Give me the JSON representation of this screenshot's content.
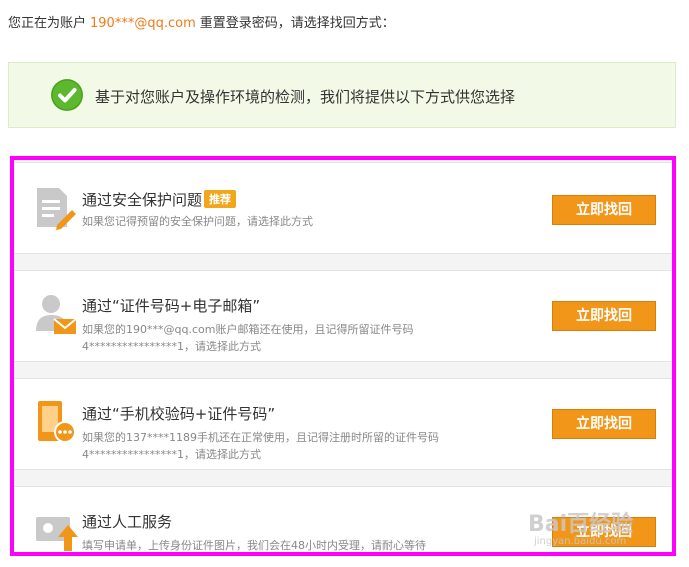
{
  "header": {
    "prefix": "您正在为账户",
    "account": "190***@qq.com",
    "suffix": "重置登录密码，请选择找回方式："
  },
  "notice": {
    "icon": "check-circle-icon",
    "message": "基于对您账户及操作环境的检测，我们将提供以下方式供您选择"
  },
  "options": [
    {
      "icon": "document-pencil-icon",
      "title": "通过安全保护问题",
      "badge": "推荐",
      "desc1": "如果您记得预留的安全保护问题，请选择此方式",
      "desc2": "",
      "button": "立即找回"
    },
    {
      "icon": "person-mail-icon",
      "title": "通过“证件号码+电子邮箱”",
      "desc1": "如果您的190***@qq.com账户邮箱还在使用，且记得所留证件号码",
      "desc2": "4****************1，请选择此方式",
      "button": "立即找回"
    },
    {
      "icon": "phone-message-icon",
      "title": "通过“手机校验码+证件号码”",
      "desc1": "如果您的137****1189手机还在正常使用，且记得注册时所留的证件号码",
      "desc2": "4****************1，请选择此方式",
      "button": "立即找回"
    },
    {
      "icon": "id-card-upload-icon",
      "title": "通过人工服务",
      "desc1": "填写申请单，上传身份证件图片，我们会在48小时内受理，请耐心等待",
      "desc2": "",
      "button": "立即找回"
    }
  ],
  "watermark": {
    "main": "Bai百经验",
    "sub": "jingyan.baidu.com"
  },
  "colors": {
    "accent_orange": "#f29619",
    "account_orange": "#ef7a1a",
    "badge": "#f2a61b",
    "highlight_border": "#ff00ff",
    "success_green": "#5cb82c"
  }
}
